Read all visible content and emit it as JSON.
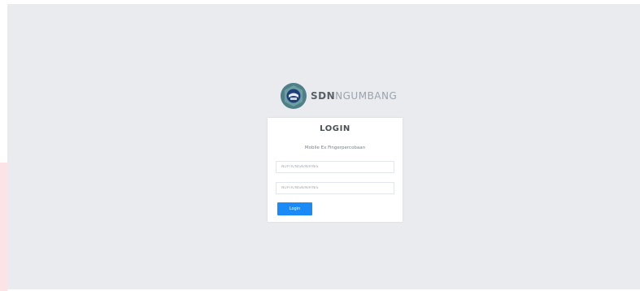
{
  "brand": {
    "name_strong": "SDN",
    "name_light": "NGUMBANG",
    "logo_icon": "school-emblem-icon"
  },
  "login": {
    "title": "LOGIN",
    "subtitle": "Mobile Ex Fingerpercobaan",
    "username_placeholder": "NUPTK/NISN/NIP/NIS",
    "password_placeholder": "NUPTK/NISN/NIP/NIS",
    "submit_label": "Login"
  },
  "colors": {
    "background": "#e9ebee",
    "card": "#ffffff",
    "button": "#1a8af7",
    "left_edge": "#fce4e6"
  }
}
